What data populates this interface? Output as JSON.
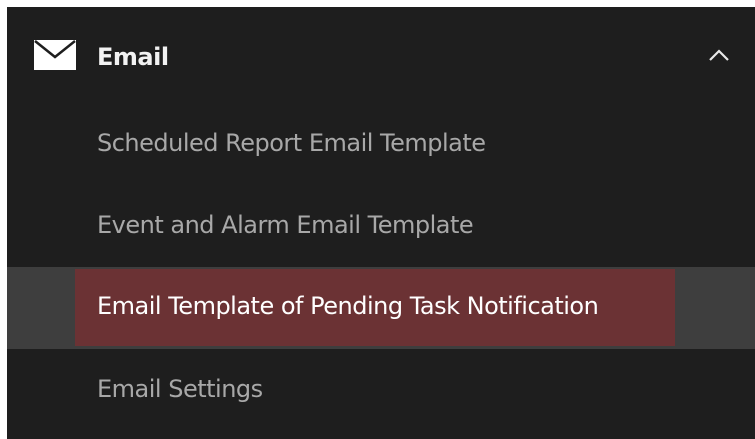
{
  "menu": {
    "section": {
      "icon": "mail-icon",
      "label": "Email",
      "toggle_icon": "chevron-up-icon",
      "expanded": true
    },
    "items": [
      {
        "label": "Scheduled Report Email Template",
        "selected": false
      },
      {
        "label": "Event and Alarm Email Template",
        "selected": false
      },
      {
        "label": "Email Template of Pending Task Notification",
        "selected": true
      },
      {
        "label": "Email Settings",
        "selected": false
      }
    ]
  },
  "colors": {
    "panel_bg": "#1e1e1e",
    "selected_row_bg": "#3e3e3e",
    "selected_highlight": "#6b3234",
    "item_text": "#a8a8a8",
    "header_text": "#f2f2f2"
  }
}
